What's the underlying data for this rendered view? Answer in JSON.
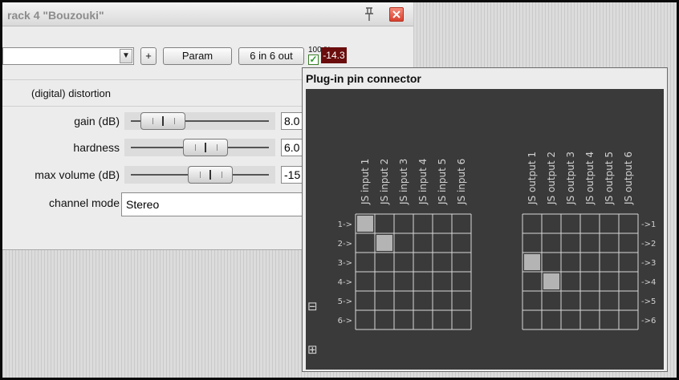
{
  "fx_window": {
    "title": "rack 4 \"Bouzouki\"",
    "icons": {
      "pin": "pin-icon",
      "close": "close-icon"
    },
    "toolbar": {
      "add_label": "+",
      "param_label": "Param",
      "routing_label": "6 in 6 out",
      "wet_label": "100 %",
      "meter_value": "-14.3"
    },
    "plugin_name": "(digital) distortion",
    "sliders": [
      {
        "label": "gain (dB)",
        "value": "8.0",
        "level": 0.15
      },
      {
        "label": "hardness",
        "value": "6.0",
        "level": 0.55
      },
      {
        "label": "max volume (dB)",
        "value": "-15",
        "level": 0.6
      }
    ],
    "channel_mode": {
      "label": "channel mode",
      "value": "Stereo"
    }
  },
  "pin_window": {
    "title": "Plug-in pin connector",
    "inputs": [
      "JS input 1",
      "JS input 2",
      "JS input 3",
      "JS input 4",
      "JS input 5",
      "JS input 6"
    ],
    "outputs": [
      "JS output 1",
      "JS output 2",
      "JS output 3",
      "JS output 4",
      "JS output 5",
      "JS output 6"
    ],
    "row_labels_in": [
      "1->",
      "2->",
      "3->",
      "4->",
      "5->",
      "6->"
    ],
    "row_labels_out": [
      "->1",
      "->2",
      "->3",
      "->4",
      "->5",
      "->6"
    ],
    "input_connections": [
      [
        0,
        0
      ],
      [
        1,
        1
      ]
    ],
    "output_connections": [
      [
        2,
        0
      ],
      [
        3,
        1
      ]
    ],
    "collapse_symbol": "⊟",
    "expand_symbol": "⊞"
  },
  "colors": {
    "grid_bg": "#3a3a3a",
    "grid_line": "#d8d8d8",
    "pin_fill": "#b4b4b4",
    "meter_bg": "#6b0d0d"
  }
}
